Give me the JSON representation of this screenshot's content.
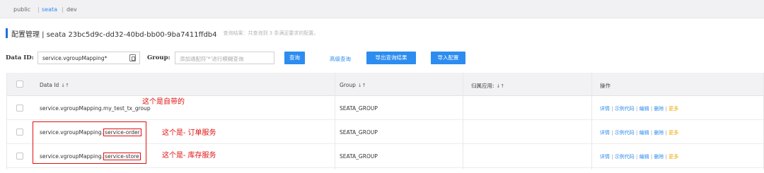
{
  "namespaces": [
    {
      "label": "public",
      "active": false
    },
    {
      "label": "seata",
      "active": true
    },
    {
      "label": "dev",
      "active": false
    }
  ],
  "ns_sep": "|",
  "header": {
    "title": "配置管理  |  seata  23bc5d9c-dd32-40bd-bb00-9ba7411ffdb4",
    "subtitle": "查询结果：共查询到 3 条满足要求的配置。"
  },
  "search": {
    "data_id_label": "Data ID:",
    "data_id_value": "service.vgroupMapping*",
    "group_label": "Group:",
    "group_placeholder": "添加通配符'*'进行模糊查询",
    "query_button": "查询",
    "advanced_link": "高级查询",
    "export_button": "导出查询结果",
    "import_button": "导入配置"
  },
  "table": {
    "headers": [
      "Data Id",
      "Group",
      "归属应用:",
      "操作"
    ],
    "sort_icon": "↓↑",
    "rows": [
      {
        "data_id_prefix": "service.vgroupMapping.my_test_tx_group",
        "data_id_highlight": "",
        "group": "SEATA_GROUP",
        "app": ""
      },
      {
        "data_id_prefix": "service.vgroupMapping.",
        "data_id_highlight": "service-order",
        "group": "SEATA_GROUP",
        "app": ""
      },
      {
        "data_id_prefix": "service.vgroupMapping.",
        "data_id_highlight": "service-store",
        "group": "SEATA_GROUP",
        "app": ""
      }
    ],
    "ops": {
      "detail": "详情",
      "sample": "示例代码",
      "edit": "编辑",
      "delete": "删除",
      "more": "更多",
      "sep": " | "
    }
  },
  "annotations": {
    "note1": "这个是自带的",
    "note2": "这个是- 订单服务",
    "note3": "这个是- 库存服务"
  },
  "colors": {
    "accent": "#2d8cf0",
    "annotation": "#e01010",
    "title_bar": "#1f6fdc"
  }
}
